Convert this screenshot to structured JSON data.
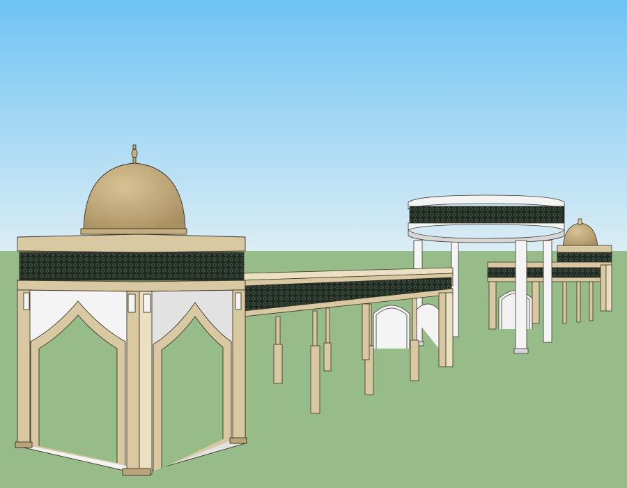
{
  "scene": {
    "description_visible_text": "",
    "colors": {
      "sky_top": "#6ec3f3",
      "sky_bottom": "#d8ecf5",
      "ground": "#97bc8a",
      "ground_far": "#8fb783",
      "stone": "#d9c9a3",
      "stone_dark": "#b9a47a",
      "stone_light": "#ece0c2",
      "dome": "#c4ad7e",
      "dome_shadow": "#a88f62",
      "lattice": "#1f2a22",
      "white": "#f4f4f4",
      "white_shade": "#d7d7d7",
      "outline": "#3b3326"
    }
  }
}
